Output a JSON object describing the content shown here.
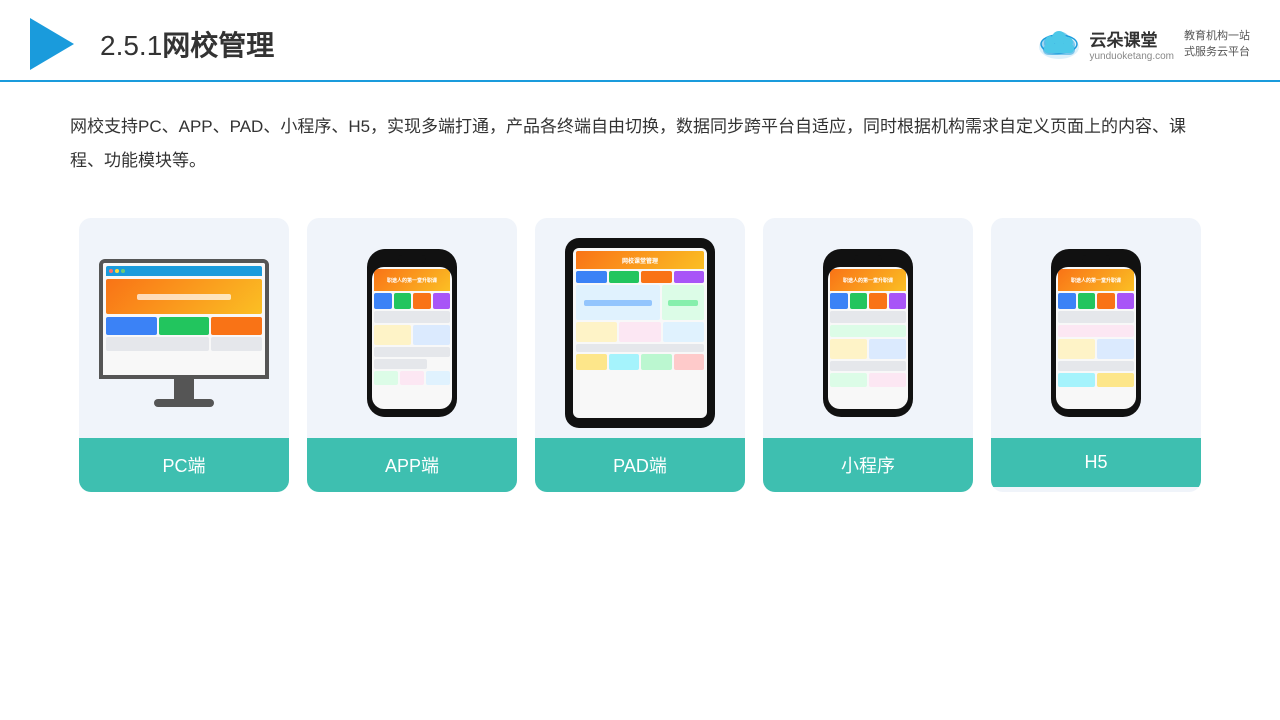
{
  "header": {
    "title_num": "2.5.1",
    "title_text": "网校管理",
    "logo_name": "云朵课堂",
    "logo_url": "yunduoketang.com",
    "logo_tagline": "教育机构一站\n式服务云平台"
  },
  "description": {
    "text": "网校支持PC、APP、PAD、小程序、H5，实现多端打通，产品各终端自由切换，数据同步跨平台自适应，同时根据机构需求自定义页面上的内容、课程、功能模块等。"
  },
  "cards": [
    {
      "id": "pc",
      "label": "PC端",
      "type": "pc"
    },
    {
      "id": "app",
      "label": "APP端",
      "type": "phone"
    },
    {
      "id": "pad",
      "label": "PAD端",
      "type": "tablet"
    },
    {
      "id": "miniprogram",
      "label": "小程序",
      "type": "phone"
    },
    {
      "id": "h5",
      "label": "H5",
      "type": "phone"
    }
  ],
  "colors": {
    "accent_blue": "#1a9bdc",
    "teal": "#3ebfb0",
    "header_border": "#1a9bdc"
  }
}
